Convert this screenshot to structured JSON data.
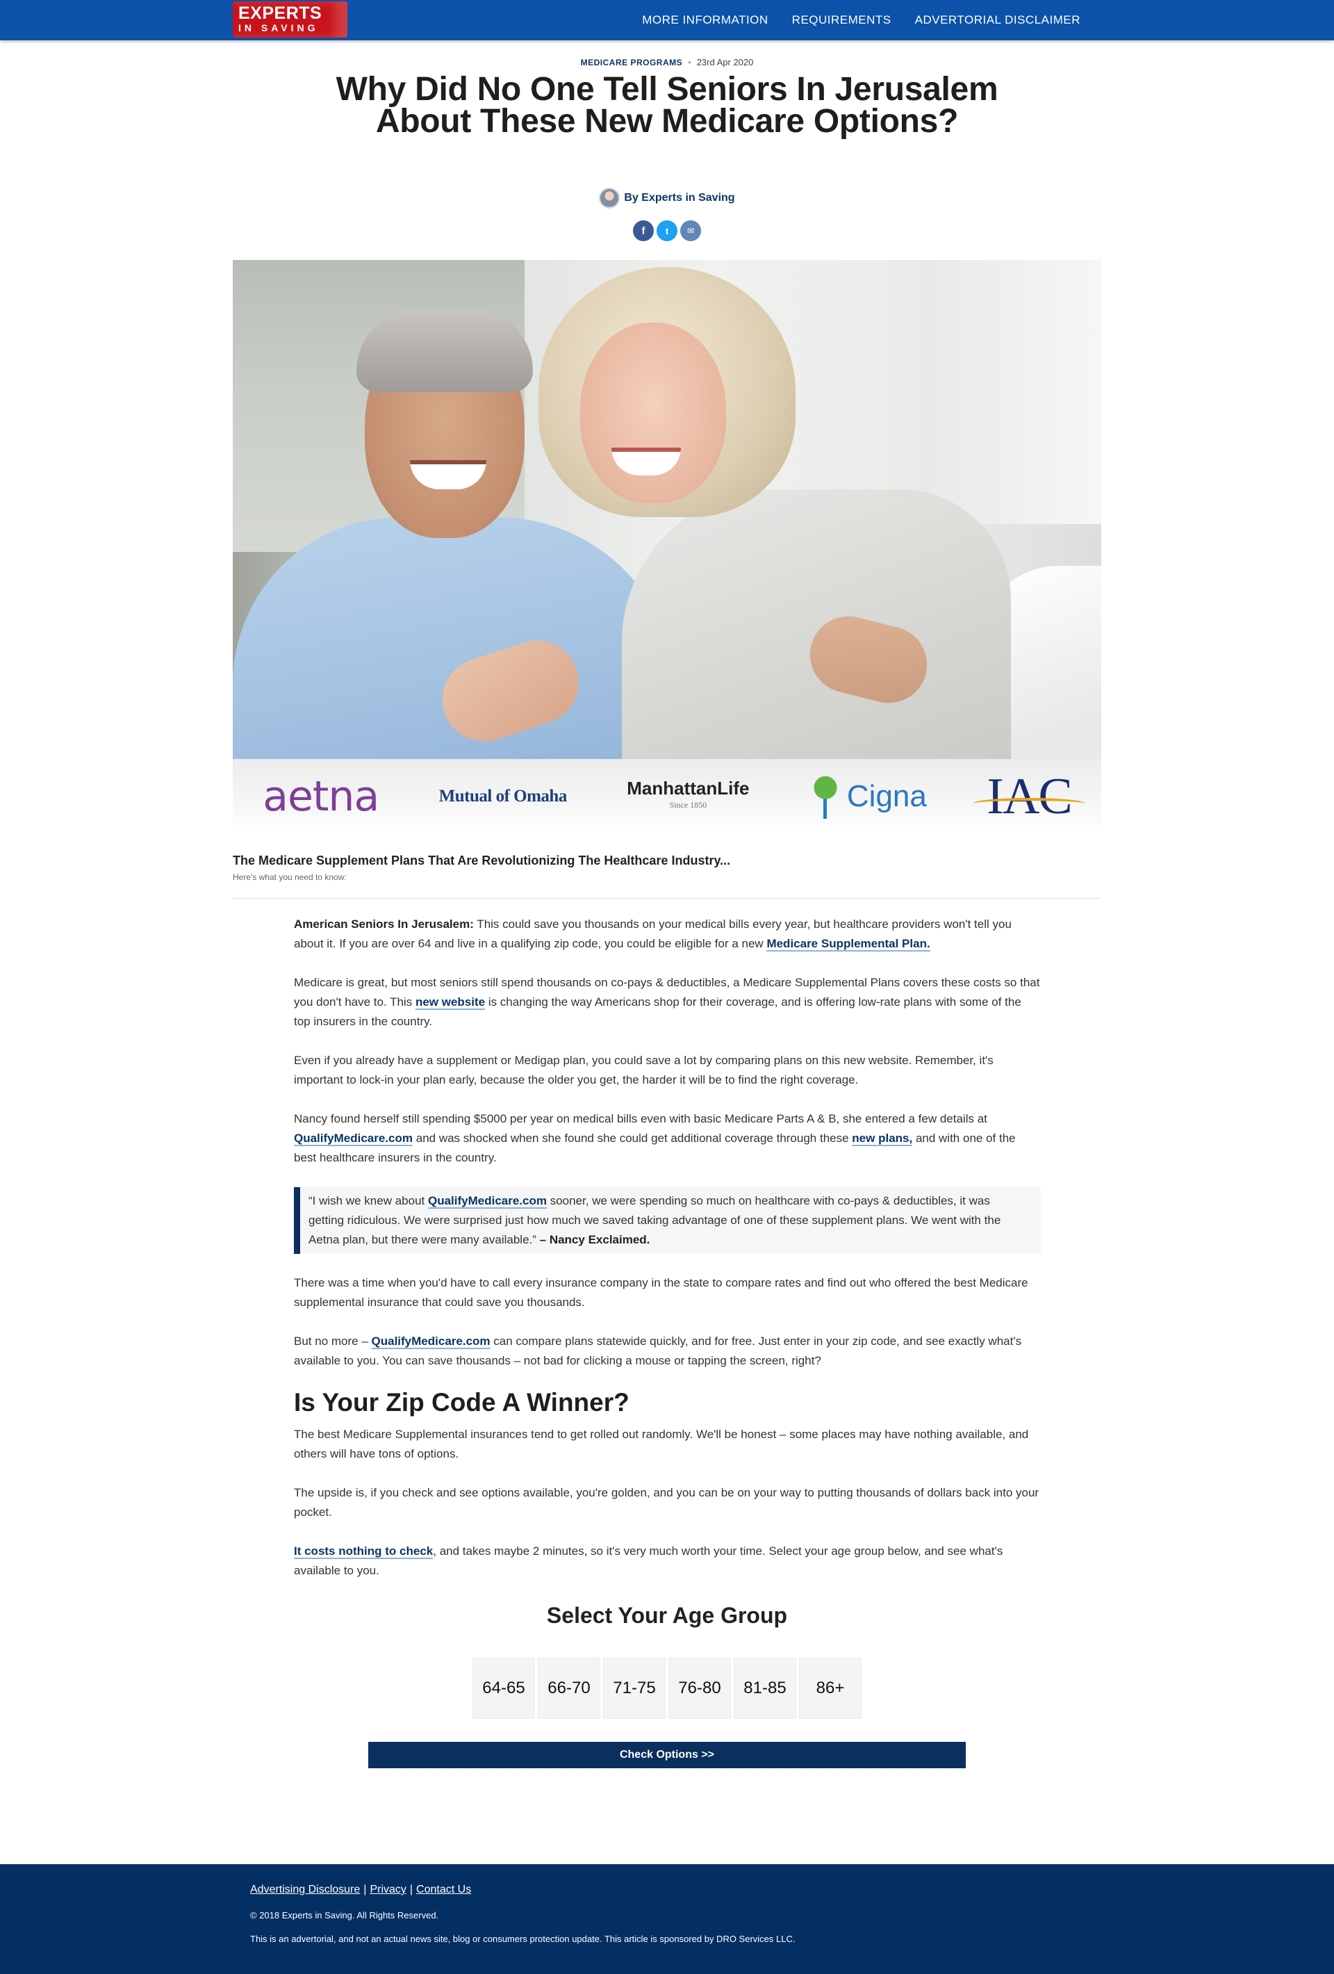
{
  "brand": {
    "logo_top": "EXPERTS",
    "logo_bottom": "IN SAVING",
    "color": "#0b52a8",
    "logo_color": "#c8131b"
  },
  "nav": {
    "items": [
      "MORE INFORMATION",
      "REQUIREMENTS",
      "ADVERTORIAL DISCLAIMER"
    ]
  },
  "article_meta": {
    "category": "MEDICARE PROGRAMS",
    "date": "23rd Apr 2020"
  },
  "headline": "Why Did No One Tell Seniors In Jerusalem About These New Medicare Options?",
  "byline": "By Experts in Saving",
  "share": {
    "facebook": "f",
    "twitter": "t",
    "email": "✉"
  },
  "insurers": {
    "aetna": "aetna",
    "mutual": "Mutual of Omaha",
    "manhattan": "ManhattanLife",
    "manhattan_since": "Since 1850",
    "cigna": "Cigna",
    "iac": "IAC"
  },
  "subhead": "The Medicare Supplement Plans That Are Revolutionizing The Healthcare Industry...",
  "subnote": "Here's what you need to know:",
  "body": {
    "p1_lead": "American Seniors In Jerusalem:",
    "p1_text": " This could save you thousands on your medical bills every year, but healthcare providers won't tell you about it. If you are over 64 and live in a qualifying zip code, you could be eligible for a new ",
    "p1_link": "Medicare Supplemental Plan.",
    "p2_a": "Medicare is great, but most seniors still spend thousands on co-pays & deductibles, a Medicare Supplemental Plans covers these costs so that you don't have to. This ",
    "p2_link": "new website",
    "p2_b": " is changing the way Americans shop for their coverage, and is offering low-rate plans with some of the top insurers in the country.",
    "p3": "Even if you already have a supplement or Medigap plan, you could save a lot by comparing plans on this new website. Remember, it's important to lock-in your plan early, because the older you get, the harder it will be to find the right coverage.",
    "p4_a": "Nancy found herself still spending $5000 per year on medical bills even with basic Medicare Parts A & B, she entered a few details at ",
    "p4_link1": "QualifyMedicare.com",
    "p4_b": " and was shocked when she found she could get additional coverage through these ",
    "p4_link2": "new plans,",
    "p4_c": " and with one of the best healthcare insurers in the country.",
    "q_a": "“I wish we knew about ",
    "q_link": "QualifyMedicare.com",
    "q_b": " sooner, we were spending so much on healthcare with co-pays & deductibles, it was getting ridiculous. We were surprised just how much we saved taking advantage of one of these supplement plans. We went with the Aetna plan, but there were many available.” ",
    "q_attr": "– Nancy Exclaimed.",
    "p5": "There was a time when you'd have to call every insurance company in the state to compare rates and find out who offered the best Medicare supplemental insurance that could save you thousands.",
    "p6_a": "But no more – ",
    "p6_link": "QualifyMedicare.com",
    "p6_b": " can compare plans statewide quickly, and for free. Just enter in your zip code, and see exactly what's available to you. You can save thousands – not bad for clicking a mouse or tapping the screen, right?",
    "h2": "Is Your Zip Code A Winner?",
    "p7": "The best Medicare Supplemental insurances tend to get rolled out randomly. We'll be honest – some places may have nothing available, and others will have tons of options.",
    "p8": "The upside is, if you check and see options available, you're golden, and you can be on your way to putting thousands of dollars back into your pocket.",
    "p9_link": "It costs nothing to check",
    "p9_b": ", and takes maybe 2 minutes, so it's very much worth your time. Select your age group below, and see what's available to you."
  },
  "age_select": {
    "title": "Select Your Age Group",
    "options": [
      "64-65",
      "66-70",
      "71-75",
      "76-80",
      "81-85",
      "86+"
    ],
    "cta": "Check Options >>"
  },
  "footer": {
    "links": [
      "Advertising Disclosure",
      "Privacy",
      "Contact Us"
    ],
    "separator": "|",
    "copyright": "© 2018 Experts in Saving. All Rights Reserved.",
    "note": "This is an advertorial, and not an actual news site, blog or consumers protection update. This article is sponsored by DRO Services LLC.",
    "bg_color": "#042f63"
  }
}
